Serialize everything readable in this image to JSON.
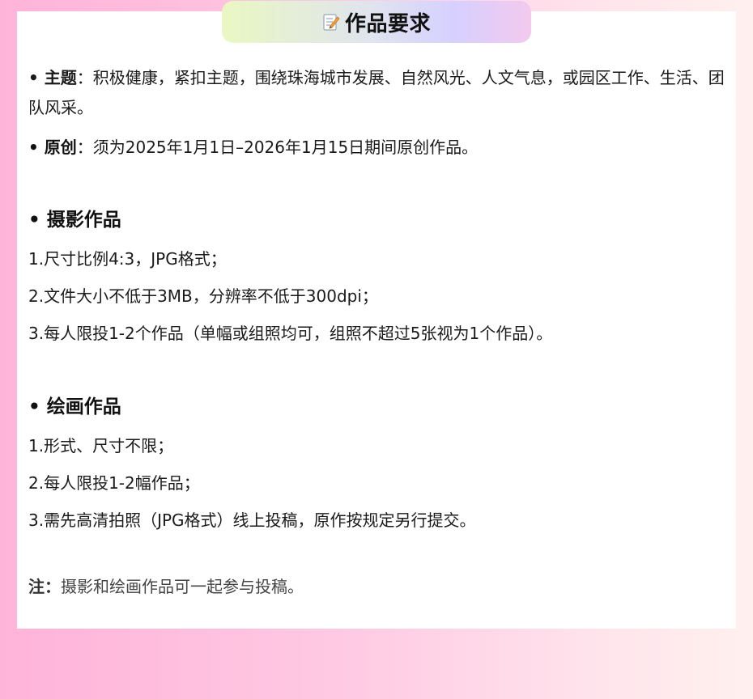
{
  "header": {
    "icon": "memo-icon",
    "title": "作品要求"
  },
  "theme": {
    "label": "主题",
    "text": "：积极健康，紧扣主题，围绕珠海城市发展、自然风光、人文气息，或园区工作、生活、团队风采。"
  },
  "original": {
    "label": "原创",
    "text": "：须为2025年1月1日–2026年1月15日期间原创作品。"
  },
  "photography": {
    "title": "• 摄影作品",
    "items": [
      "1.尺寸比例4:3，JPG格式；",
      "2.文件大小不低于3MB，分辨率不低于300dpi；",
      "3.每人限投1-2个作品（单幅或组照均可，组照不超过5张视为1个作品）。"
    ]
  },
  "painting": {
    "title": "• 绘画作品",
    "items": [
      "1.形式、尺寸不限；",
      "2.每人限投1-2幅作品；",
      "3.需先高清拍照（JPG格式）线上投稿，原作按规定另行提交。"
    ]
  },
  "note": {
    "label": "注：",
    "text": "摄影和绘画作品可一起参与投稿。"
  },
  "colors": {
    "page_bg_left": "#ffb3d9",
    "page_bg_right": "#fff0ee",
    "card_bg": "#ffffff"
  }
}
